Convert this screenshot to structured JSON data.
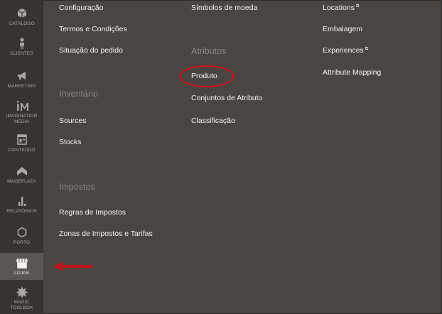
{
  "sidebar": {
    "items": [
      {
        "label": "CATÁLOGO",
        "icon": "cube-icon"
      },
      {
        "label": "CLIENTES",
        "icon": "person-icon"
      },
      {
        "label": "MARKETING",
        "icon": "megaphone-icon"
      },
      {
        "label": "IMAGINATION MEDIA",
        "icon": "im-logo-icon"
      },
      {
        "label": "CONTEÚDO",
        "icon": "layout-icon"
      },
      {
        "label": "MAGEPLAZA",
        "icon": "mageplaza-icon"
      },
      {
        "label": "RELATÓRIOS",
        "icon": "bar-chart-icon"
      },
      {
        "label": "PORTO",
        "icon": "hexagon-icon"
      },
      {
        "label": "LOJAS",
        "icon": "store-icon",
        "active": true
      },
      {
        "label": "MAGIC TOOLBOX",
        "icon": "burst-icon"
      }
    ]
  },
  "menu": {
    "col1": {
      "configuracao": "Configuração",
      "termos": "Termos e Condições",
      "situacao": "Situação do pedido",
      "inventario_heading": "Inventário",
      "sources": "Sources",
      "stocks": "Stocks",
      "impostos_heading": "Impostos",
      "regras": "Regras de Impostos",
      "zonas": "Zonas de Impostos e Tarifas"
    },
    "col2": {
      "simbolos": "Símbolos de moeda",
      "atributos_heading": "Atributos",
      "produto": "Produto",
      "conjuntos": "Conjuntos de Atributo",
      "classificacao": "Classificação"
    },
    "col3": {
      "locations": "Locations",
      "embalagem": "Embalagem",
      "experiences": "Experiences",
      "attribute_mapping": "Attribute Mapping"
    }
  },
  "ext_glyph": "⧉",
  "colors": {
    "sidebar": "#373330",
    "panel": "#4a4542",
    "highlight": "#d0151b"
  }
}
